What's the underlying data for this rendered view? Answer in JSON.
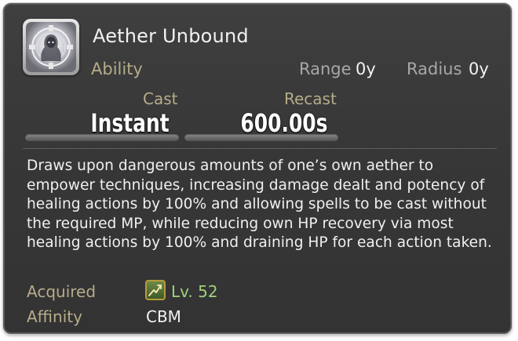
{
  "action": {
    "name": "Aether Unbound",
    "type": "Ability",
    "icon": "aether-unbound-icon"
  },
  "range": {
    "label": "Range",
    "value": "0y"
  },
  "radius": {
    "label": "Radius",
    "value": "0y"
  },
  "cast": {
    "label": "Cast",
    "value": "Instant"
  },
  "recast": {
    "label": "Recast",
    "value": "600.00s"
  },
  "description": "Draws upon dangerous amounts of one’s own aether to empower techniques, increasing damage dealt and potency of healing actions by 100% and allowing spells to be cast without the required MP, while reducing own HP recovery via most healing actions by 100% and draining HP for each action taken.",
  "acquired": {
    "label": "Acquired",
    "level": "Lv. 52",
    "icon": "class-level-icon"
  },
  "affinity": {
    "label": "Affinity",
    "value": "CBM"
  },
  "colors": {
    "panel_background": "#383838",
    "accent_label": "#b5ac8a",
    "level_green": "#9fd27a",
    "text": "#f0f0f0"
  }
}
